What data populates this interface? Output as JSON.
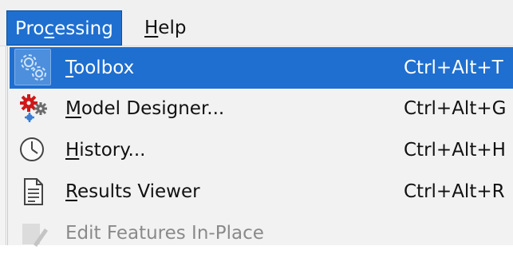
{
  "menubar": {
    "items": [
      {
        "pre": "Pro",
        "mnemonic": "c",
        "post": "essing",
        "active": true
      },
      {
        "pre": "",
        "mnemonic": "H",
        "post": "elp",
        "active": false
      }
    ]
  },
  "dropdown": {
    "items": [
      {
        "pre": "",
        "mnemonic": "T",
        "post": "oolbox",
        "shortcut": "Ctrl+Alt+T",
        "icon": "gears-icon",
        "highlighted": true,
        "enabled": true
      },
      {
        "pre": "",
        "mnemonic": "M",
        "post": "odel Designer...",
        "shortcut": "Ctrl+Alt+G",
        "icon": "model-designer-icon",
        "highlighted": false,
        "enabled": true
      },
      {
        "pre": "",
        "mnemonic": "H",
        "post": "istory...",
        "shortcut": "Ctrl+Alt+H",
        "icon": "clock-icon",
        "highlighted": false,
        "enabled": true
      },
      {
        "pre": "",
        "mnemonic": "R",
        "post": "esults Viewer",
        "shortcut": "Ctrl+Alt+R",
        "icon": "document-icon",
        "highlighted": false,
        "enabled": true
      },
      {
        "pre": "",
        "mnemonic": "",
        "post": "Edit Features In-Place",
        "shortcut": "",
        "icon": "edit-in-place-icon",
        "highlighted": false,
        "enabled": false
      }
    ]
  },
  "colors": {
    "highlight": "#1e6fd0",
    "menu_background": "#f2f2f2",
    "disabled_text": "#8a8a8a"
  }
}
